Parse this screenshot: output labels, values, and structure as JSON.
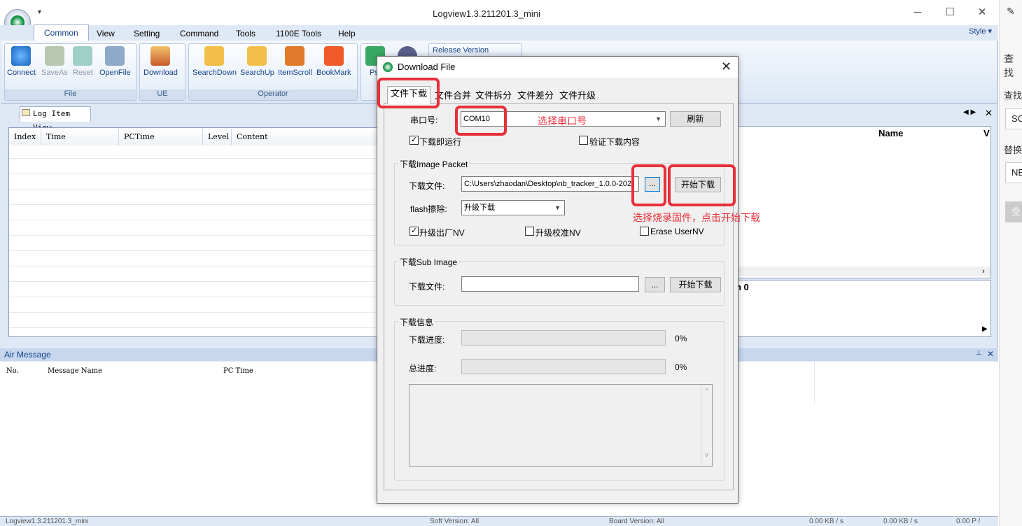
{
  "app": {
    "title": "Logview1.3.211201.3_mini",
    "tabs": [
      "Common",
      "View",
      "Setting",
      "Command",
      "Tools",
      "1100E Tools",
      "Help"
    ],
    "style_label": "Style",
    "groups": {
      "file": "File",
      "ue": "UE",
      "operator": "Operator"
    },
    "buttons": [
      "Connect",
      "SaveAs",
      "Reset",
      "OpenFile",
      "Download",
      "SearchDown",
      "SearchUp",
      "ItemScroll",
      "BookMark",
      "Ps/"
    ],
    "release_label": "Release Version",
    "log_tab": "Log Item View",
    "log_columns": [
      "Index",
      "Time",
      "PCTime",
      "Level",
      "Content"
    ],
    "right_header": "Name",
    "right_text": "n 0",
    "air_title": "Air Message",
    "air_columns": [
      "No.",
      "Message Name",
      "PC Time"
    ],
    "status": [
      "Logview1.3.211201.3_mini",
      "Soft Version: All",
      "Board Version: All",
      "0.00 KB / s",
      "0.00 KB / s",
      "0.00 P /"
    ]
  },
  "side": {
    "texts": [
      "查找",
      "查找",
      "替换"
    ],
    "fields": [
      "SC",
      "NE",
      "全"
    ]
  },
  "dialog": {
    "title": "Download File",
    "tabs": [
      "文件下载",
      "文件合并",
      "文件拆分",
      "文件差分",
      "文件升级"
    ],
    "port_label": "串口号:",
    "port_value": "COM10",
    "refresh": "刷新",
    "run_after": "下载即运行",
    "verify": "验证下载内容",
    "image_group": "下载Image Packet",
    "file_label": "下载文件:",
    "file_path": "C:\\Users\\zhaodan\\Desktop\\nb_tracker_1.0.0-202",
    "browse": "...",
    "start": "开始下载",
    "flash_label": "flash擦除:",
    "flash_value": "升级下载",
    "nv1": "升级出厂NV",
    "nv2": "升级校准NV",
    "nv3": "Erase UserNV",
    "sub_group": "下载Sub Image",
    "info_group": "下载信息",
    "progress_label": "下载进度:",
    "total_label": "总进度:",
    "progress": "0%",
    "total": "0%"
  },
  "annotations": {
    "port": "选择串口号",
    "firmware": "选择烧录固件，点击开始下载"
  },
  "colors": {
    "accent": "#15428b",
    "annotation": "#e8303a"
  }
}
